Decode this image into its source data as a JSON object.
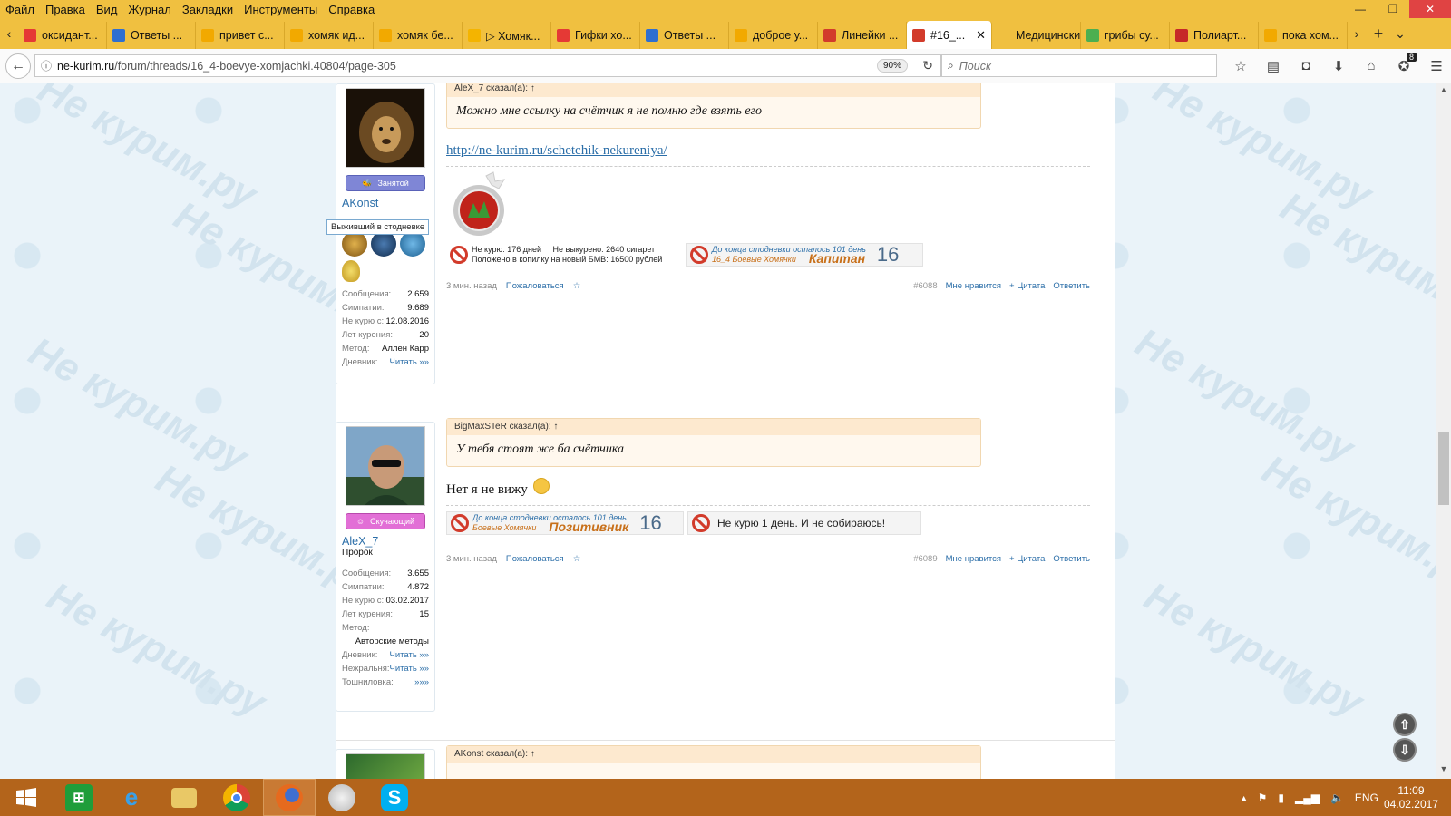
{
  "menubar": {
    "items": [
      "Файл",
      "Правка",
      "Вид",
      "Журнал",
      "Закладки",
      "Инструменты",
      "Справка"
    ]
  },
  "tabs": [
    {
      "label": "оксидант...",
      "icon": "yandex-icon",
      "color": "#e53935"
    },
    {
      "label": "Ответы ...",
      "icon": "question-icon",
      "color": "#2f6fd0"
    },
    {
      "label": "привет с...",
      "icon": "hamster-icon",
      "color": "#f2a900"
    },
    {
      "label": "хомяк ид...",
      "icon": "hamster-icon",
      "color": "#f2a900"
    },
    {
      "label": "хомяк бе...",
      "icon": "hamster-icon",
      "color": "#f2a900"
    },
    {
      "label": "▷ Хомяк...",
      "icon": "star-icon",
      "color": "#f4b400"
    },
    {
      "label": "Гифки хо...",
      "icon": "hamster-icon",
      "color": "#e53935"
    },
    {
      "label": "Ответы ...",
      "icon": "question-icon",
      "color": "#2f6fd0"
    },
    {
      "label": "доброе у...",
      "icon": "hamster-icon",
      "color": "#f2a900"
    },
    {
      "label": "Линейки ...",
      "icon": "no-smoking-icon",
      "color": "#d23b2b"
    },
    {
      "label": "#16_...",
      "icon": "no-smoking-icon",
      "color": "#d23b2b",
      "active": true
    },
    {
      "label": "Медицински...",
      "icon": "blank-icon",
      "color": "#f0c040"
    },
    {
      "label": "грибы су...",
      "icon": "colorful-icon",
      "color": "#4caf50"
    },
    {
      "label": "Полиарт...",
      "icon": "red-circle-icon",
      "color": "#c62828"
    },
    {
      "label": "пока хом...",
      "icon": "hamster-icon",
      "color": "#f2a900"
    }
  ],
  "navbar": {
    "url_domain": "ne-kurim.ru",
    "url_path": "/forum/threads/16_4-boevye-xomjachki.40804/page-305",
    "zoom": "90%",
    "search_placeholder": "Поиск",
    "downloads_badge": "8"
  },
  "posts": [
    {
      "user": {
        "name": "AKonst",
        "status_label": "Занятой",
        "status_color": "#8d8dd6",
        "tooltip": "Выживший в стодневке",
        "stats": [
          {
            "k": "Сообщения:",
            "v": "2.659"
          },
          {
            "k": "Симпатии:",
            "v": "9.689"
          },
          {
            "k": "Не курю с:",
            "v": "12.08.2016"
          },
          {
            "k": "Лет курения:",
            "v": "20"
          },
          {
            "k": "Метод:",
            "v": "Аллен Карр"
          },
          {
            "k": "Дневник:",
            "v": "Читать »»",
            "link": true
          }
        ]
      },
      "quote_header": "AleX_7 сказал(а): ↑",
      "quote_text": "Можно мне ссылку на счётчик я не помню где взять его",
      "link": "http://ne-kurim.ru/schetchik-nekureniya/",
      "counter": {
        "line1_a": "Не курю: 176 дней",
        "line1_b": "Не выкурено: 2640 сигарет",
        "line2": "Положено в копилку на новый БМВ: 16500 рублей"
      },
      "banner": {
        "line1": "До конца стодневки осталось 101 день",
        "line2": "16_4 Боевые Хомячки",
        "rank": "Капитан",
        "num": "16"
      },
      "footer": {
        "time": "3 мин. назад",
        "report": "Пожаловаться",
        "star": "☆",
        "num": "#6088",
        "like": "Мне нравится",
        "quote": "+ Цитата",
        "reply": "Ответить"
      }
    },
    {
      "user": {
        "name": "AleX_7",
        "title": "Пророк",
        "status_label": "Скучающий",
        "status_color": "#d77ad0",
        "stats": [
          {
            "k": "Сообщения:",
            "v": "3.655"
          },
          {
            "k": "Симпатии:",
            "v": "4.872"
          },
          {
            "k": "Не курю с:",
            "v": "03.02.2017"
          },
          {
            "k": "Лет курения:",
            "v": "15"
          },
          {
            "k": "Метод:",
            "v": ""
          },
          {
            "k": "",
            "v": "Авторские методы",
            "full": true
          },
          {
            "k": "Дневник:",
            "v": "Читать »»",
            "link": true
          },
          {
            "k": "Нежральня:",
            "v": "Читать »»",
            "link": true
          },
          {
            "k": "Тошниловка:",
            "v": "»»»",
            "link": true
          }
        ]
      },
      "quote_header": "BigMaxSTeR сказал(а): ↑",
      "quote_text": "У тебя стоят же ба счётчика",
      "text": "Нет я не вижу",
      "banner": {
        "line1": "До конца стодневки осталось 101 день",
        "line2": "Боевые Хомячки",
        "rank": "Позитивник",
        "num": "16"
      },
      "banner2": "Не курю 1 день. И не собираюсь!",
      "footer": {
        "time": "3 мин. назад",
        "report": "Пожаловаться",
        "star": "☆",
        "num": "#6089",
        "like": "Мне нравится",
        "quote": "+ Цитата",
        "reply": "Ответить"
      }
    },
    {
      "quote_header": "AKonst сказал(а): ↑"
    }
  ],
  "watermark": "Не курим.ру",
  "taskbar": {
    "lang": "ENG",
    "time": "11:09",
    "date": "04.02.2017"
  }
}
